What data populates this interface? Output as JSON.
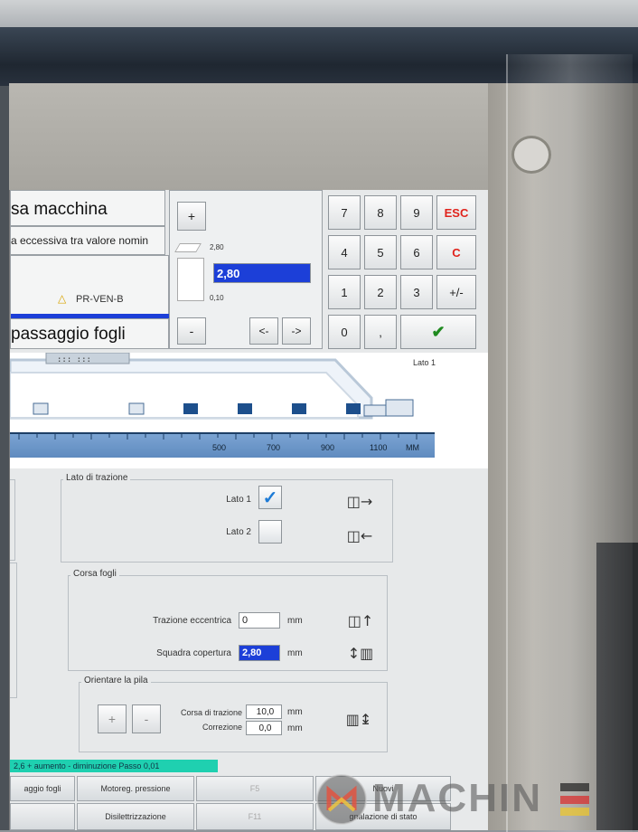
{
  "header": {
    "title_top": "sa macchina",
    "message": "a eccessiva tra valore nomin",
    "warning_code": "PR-VEN-B",
    "title_bottom": "passaggio fogli"
  },
  "editor": {
    "plus_label": "+",
    "minus_label": "-",
    "max_value": "2,80",
    "min_value": "0,10",
    "current_value": "2,80",
    "left_label": "<-",
    "right_label": "->",
    "level_fraction": 0.93
  },
  "keypad": {
    "keys": [
      "7",
      "8",
      "9",
      "ESC",
      "4",
      "5",
      "6",
      "C",
      "1",
      "2",
      "3",
      "+/-",
      "0",
      ","
    ],
    "confirm_icon": "check-icon"
  },
  "diagram": {
    "side_label": "Lato 1",
    "ruler_ticks": [
      "500",
      "700",
      "900",
      "1100"
    ],
    "unit": "MM"
  },
  "lato_di_trazione": {
    "title": "Lato di trazione",
    "lato1_label": "Lato 1",
    "lato1_checked": true,
    "lato2_label": "Lato 2",
    "lato2_checked": false
  },
  "corsa_fogli": {
    "title": "Corsa fogli",
    "trazione_label": "Trazione eccentrica",
    "trazione_value": "0",
    "trazione_unit": "mm",
    "squadra_label": "Squadra copertura",
    "squadra_value": "2,80",
    "squadra_unit": "mm"
  },
  "orientare_pila": {
    "title": "Orientare la pila",
    "plus_label": "+",
    "minus_label": "-",
    "corsa_label": "Corsa di trazione",
    "corsa_value": "10,0",
    "corsa_unit": "mm",
    "correzione_label": "Correzione",
    "correzione_value": "0,0",
    "correzione_unit": "mm"
  },
  "status": {
    "text": "2,6    + aumento - diminuzione  Passo 0,01"
  },
  "function_keys": {
    "k1": "aggio fogli",
    "k2": "Motoreg. pressione",
    "k3": "F5",
    "k4": "Nuovi",
    "k5": "Disilettrizzazione",
    "k6": "F11",
    "k7": "gnalazione di stato"
  },
  "watermark": {
    "text": "MACHIN"
  },
  "colors": {
    "selection_blue": "#1c3fd8",
    "status_teal": "#1fd0b0",
    "ruler_blue": "#5f8bbf",
    "esc_red": "#e0231c",
    "confirm_green": "#1f8a1f"
  }
}
